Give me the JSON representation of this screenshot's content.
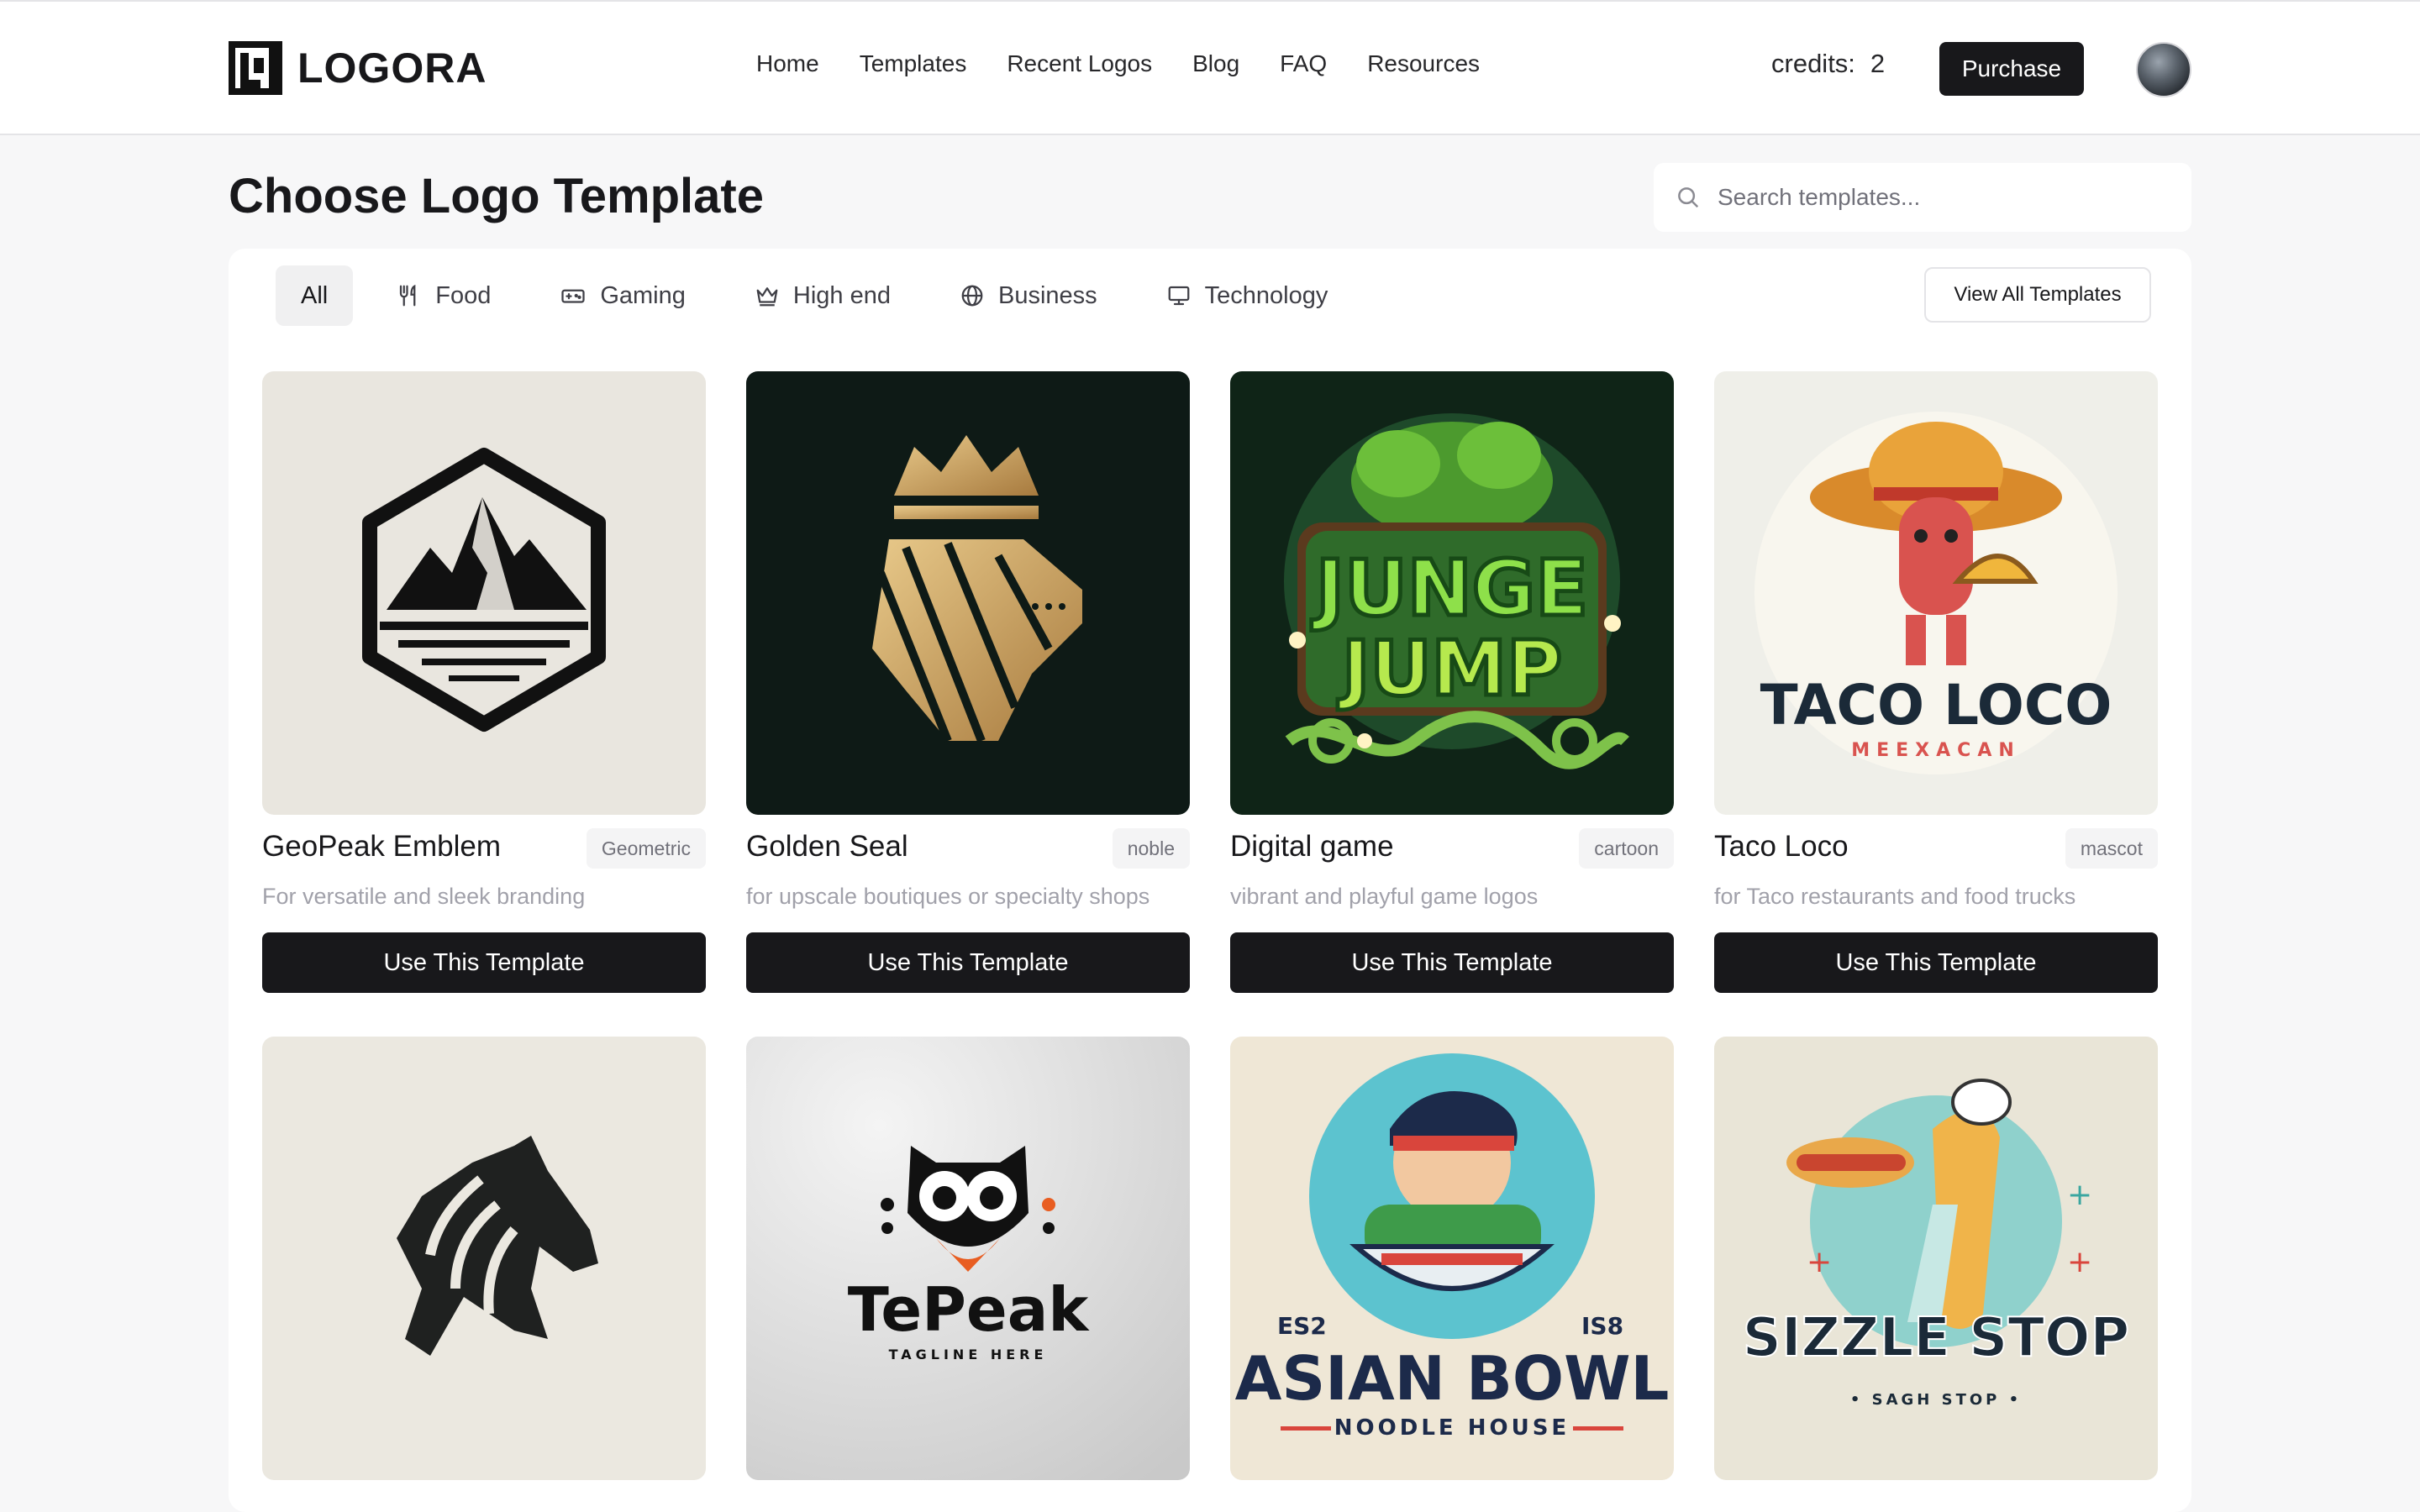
{
  "header": {
    "logo_text": "LOGORA",
    "nav": [
      "Home",
      "Templates",
      "Recent Logos",
      "Blog",
      "FAQ",
      "Resources"
    ],
    "credits_label": "credits:",
    "credits_value": "2",
    "purchase_label": "Purchase"
  },
  "page": {
    "title": "Choose Logo Template",
    "search_placeholder": "Search templates..."
  },
  "filters": {
    "chips": [
      {
        "label": "All",
        "icon": "none",
        "active": true
      },
      {
        "label": "Food",
        "icon": "utensils-icon"
      },
      {
        "label": "Gaming",
        "icon": "gamepad-icon"
      },
      {
        "label": "High end",
        "icon": "crown-icon"
      },
      {
        "label": "Business",
        "icon": "globe-icon"
      },
      {
        "label": "Technology",
        "icon": "monitor-icon"
      }
    ],
    "view_all_label": "View All Templates"
  },
  "cards": [
    {
      "title": "GeoPeak Emblem",
      "tag": "Geometric",
      "desc": "For versatile and sleek branding",
      "button": "Use This Template"
    },
    {
      "title": "Golden Seal",
      "tag": "noble",
      "desc": "for upscale boutiques or specialty shops",
      "button": "Use This Template"
    },
    {
      "title": "Digital game",
      "tag": "cartoon",
      "desc": "vibrant and playful game logos",
      "button": "Use This Template",
      "art_text": [
        "JUNGE",
        "JUMP"
      ]
    },
    {
      "title": "Taco Loco",
      "tag": "mascot",
      "desc": "for Taco restaurants and food trucks",
      "button": "Use This Template",
      "art_text": [
        "TACO LOCO",
        "MEEXACAN"
      ]
    },
    {
      "art_text": []
    },
    {
      "art_text": [
        "TePeak",
        "TAGLINE HERE"
      ]
    },
    {
      "art_text": [
        "ES2",
        "IS8",
        "ASIAN BOWL",
        "NOODLE HOUSE"
      ]
    },
    {
      "art_text": [
        "SIZZLE STOP",
        "• SAGH STOP •"
      ]
    }
  ]
}
